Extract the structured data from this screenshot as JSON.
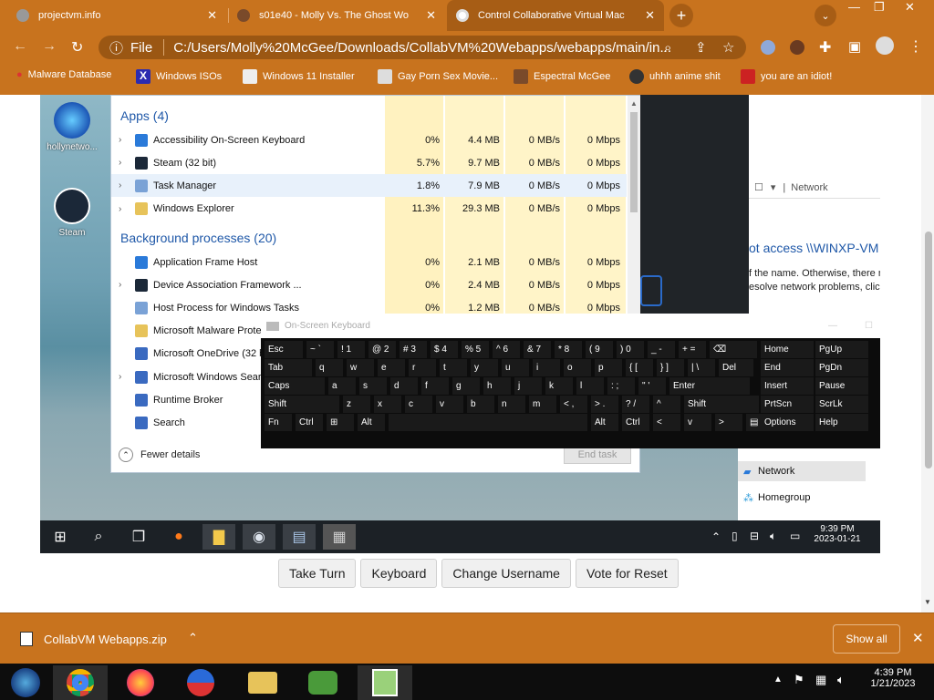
{
  "browser": {
    "tabs": [
      {
        "title": "projectvm.info",
        "active": false
      },
      {
        "title": "s01e40 - Molly Vs. The Ghost Wo",
        "active": false
      },
      {
        "title": "Control Collaborative Virtual Mac",
        "active": true
      }
    ],
    "new_tab": "+",
    "address": {
      "prefix": "File",
      "url": "C:/Users/Molly%20McGee/Downloads/CollabVM%20Webapps/webapps/main/in..."
    },
    "bookmarks": [
      "Malware Database",
      "Windows ISOs",
      "Windows 11 Installer",
      "Gay Porn Sex Movie...",
      "Espectral McGee",
      "uhhh anime shit",
      "you are an idiot!"
    ]
  },
  "vm": {
    "desktop_icons": [
      "hollynetwo...",
      "Steam"
    ],
    "task_manager": {
      "apps_header": "Apps (4)",
      "apps": [
        {
          "name": "Accessibility On-Screen Keyboard",
          "cpu": "0%",
          "mem": "4.4 MB",
          "disk": "0 MB/s",
          "net": "0 Mbps"
        },
        {
          "name": "Steam (32 bit)",
          "cpu": "5.7%",
          "mem": "9.7 MB",
          "disk": "0 MB/s",
          "net": "0 Mbps"
        },
        {
          "name": "Task Manager",
          "cpu": "1.8%",
          "mem": "7.9 MB",
          "disk": "0 MB/s",
          "net": "0 Mbps"
        },
        {
          "name": "Windows Explorer",
          "cpu": "11.3%",
          "mem": "29.3 MB",
          "disk": "0 MB/s",
          "net": "0 Mbps"
        }
      ],
      "bg_header": "Background processes (20)",
      "background": [
        {
          "name": "Application Frame Host",
          "cpu": "0%",
          "mem": "2.1 MB",
          "disk": "0 MB/s",
          "net": "0 Mbps"
        },
        {
          "name": "Device Association Framework ...",
          "cpu": "0%",
          "mem": "2.4 MB",
          "disk": "0 MB/s",
          "net": "0 Mbps"
        },
        {
          "name": "Host Process for Windows Tasks",
          "cpu": "0%",
          "mem": "1.2 MB",
          "disk": "0 MB/s",
          "net": "0 Mbps"
        },
        {
          "name": "Microsoft Malware Prote",
          "cpu": "",
          "mem": "",
          "disk": "",
          "net": ""
        },
        {
          "name": "Microsoft OneDrive (32 b",
          "cpu": "",
          "mem": "",
          "disk": "",
          "net": ""
        },
        {
          "name": "Microsoft Windows Searc",
          "cpu": "",
          "mem": "",
          "disk": "",
          "net": ""
        },
        {
          "name": "Runtime Broker",
          "cpu": "",
          "mem": "",
          "disk": "",
          "net": ""
        },
        {
          "name": "Search",
          "cpu": "",
          "mem": "",
          "disk": "",
          "net": ""
        }
      ],
      "fewer_details": "Fewer details",
      "end_task": "End task"
    },
    "explorer": {
      "crumb": "Network",
      "error_title": "ot access \\\\WINXP-VM",
      "error_line1": "f the name. Otherwise, there m",
      "error_line2": "esolve network problems, click",
      "nav_network": "Network",
      "nav_homegroup": "Homegroup"
    },
    "osk": {
      "title": "On-Screen Keyboard",
      "rows": [
        [
          "Esc",
          "~ `",
          "! 1",
          "@ 2",
          "# 3",
          "$ 4",
          "% 5",
          "^ 6",
          "& 7",
          "* 8",
          "( 9",
          ") 0",
          "_ -",
          "+ =",
          "⌫"
        ],
        [
          "Tab",
          "q",
          "w",
          "e",
          "r",
          "t",
          "y",
          "u",
          "i",
          "o",
          "p",
          "{ [",
          "} ]",
          "| \\",
          "Del"
        ],
        [
          "Caps",
          "a",
          "s",
          "d",
          "f",
          "g",
          "h",
          "j",
          "k",
          "l",
          ": ;",
          "\" '",
          "Enter"
        ],
        [
          "Shift",
          "z",
          "x",
          "c",
          "v",
          "b",
          "n",
          "m",
          "< ,",
          "> .",
          "? /",
          "^",
          "Shift"
        ],
        [
          "Fn",
          "Ctrl",
          "⊞",
          "Alt",
          "",
          "Alt",
          "Ctrl",
          "<",
          "v",
          ">",
          "▤"
        ]
      ],
      "side": [
        [
          "Home",
          "PgUp"
        ],
        [
          "End",
          "PgDn"
        ],
        [
          "Insert",
          "Pause"
        ],
        [
          "PrtScn",
          "ScrLk"
        ],
        [
          "Options",
          "Help"
        ]
      ]
    },
    "clock": {
      "time": "9:39 PM",
      "date": "2023-01-21"
    }
  },
  "vm_buttons": [
    "Take Turn",
    "Keyboard",
    "Change Username",
    "Vote for Reset"
  ],
  "download": {
    "file": "CollabVM Webapps.zip",
    "show_all": "Show all"
  },
  "host_clock": {
    "time": "4:39 PM",
    "date": "1/21/2023"
  }
}
